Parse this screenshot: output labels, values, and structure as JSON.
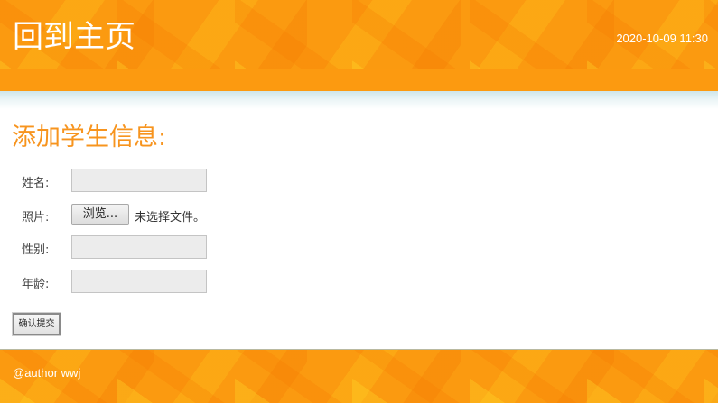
{
  "header": {
    "home_link": "回到主页",
    "datetime": "2020-10-09 11:30"
  },
  "main": {
    "title": "添加学生信息:",
    "form": {
      "name_label": "姓名:",
      "name_value": "",
      "photo_label": "照片:",
      "browse_label": "浏览...",
      "file_status": "未选择文件。",
      "gender_label": "性别:",
      "gender_value": "",
      "age_label": "年龄:",
      "age_value": "",
      "submit_label": "确认提交"
    }
  },
  "footer": {
    "text": "@author wwj"
  },
  "colors": {
    "header_orange": "#fb9a10",
    "title_orange": "#f7941e",
    "input_background": "#ececec"
  }
}
